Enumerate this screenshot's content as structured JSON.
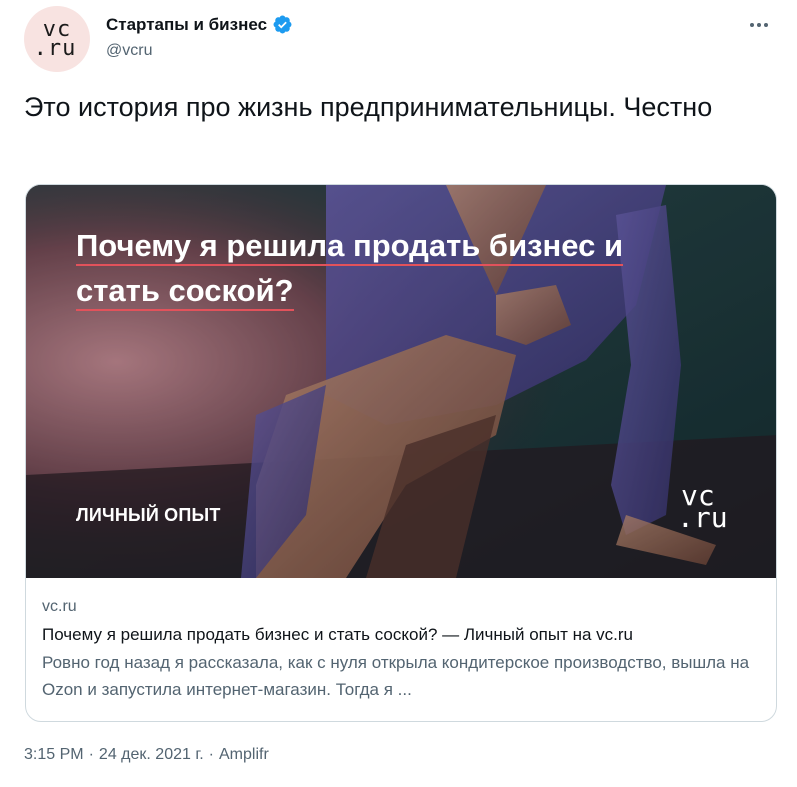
{
  "author": {
    "display_name": "Стартапы и бизнес",
    "handle": "@vcru",
    "avatar_logo": [
      "vc",
      ".ru"
    ],
    "verified_icon": "verified-badge-icon",
    "verified_color": "#1d9bf0"
  },
  "tweet": {
    "text": "Это история про жизнь предпринимательницы. Честно",
    "more_icon": "more-dots-icon"
  },
  "card": {
    "media": {
      "headline_line1": "Почему я решила продать бизнес и",
      "headline_line2": "стать соской?",
      "tag": "ЛИЧНЫЙ ОПЫТ",
      "logo": [
        "vc",
        ".ru"
      ],
      "underline_color": "#e2525b"
    },
    "domain": "vc.ru",
    "title": "Почему я решила продать бизнес и стать соской? — Личный опыт на vc.ru",
    "description": "Ровно год назад я рассказала, как с нуля открыла кондитерское производство, вышла на Ozon и запустила интернет-магазин. Тогда я ..."
  },
  "meta": {
    "time": "3:15 PM",
    "separator": "·",
    "date": "24 дек. 2021 г.",
    "source": "Amplifr"
  }
}
